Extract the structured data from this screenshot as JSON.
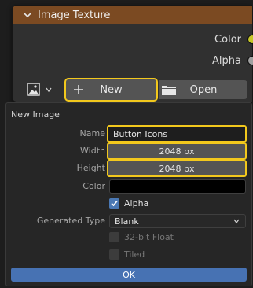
{
  "node": {
    "title": "Image Texture",
    "outputs": [
      {
        "label": "Color",
        "socket_color": "#c7c729"
      },
      {
        "label": "Alpha",
        "socket_color": "#a1a1a1"
      }
    ],
    "image_picker_icon": "image-icon",
    "new_button": {
      "label": "New",
      "icon": "plus-icon"
    },
    "open_button": {
      "label": "Open",
      "icon": "folder-icon"
    }
  },
  "popup": {
    "title": "New Image",
    "name": {
      "label": "Name",
      "value": "Button Icons"
    },
    "width": {
      "label": "Width",
      "value": "2048 px"
    },
    "height": {
      "label": "Height",
      "value": "2048 px"
    },
    "color": {
      "label": "Color",
      "value": "#000000"
    },
    "alpha": {
      "label": "Alpha",
      "checked": true
    },
    "generated_type": {
      "label": "Generated Type",
      "value": "Blank"
    },
    "float32": {
      "label": "32-bit Float",
      "checked": false,
      "disabled": true
    },
    "tiled": {
      "label": "Tiled",
      "checked": false,
      "disabled": true
    },
    "ok_label": "OK"
  },
  "colors": {
    "header": "#7b4a22",
    "highlight": "#f2c81d",
    "ok_button": "#4772b3",
    "checkbox_checked": "#4a78b4"
  }
}
